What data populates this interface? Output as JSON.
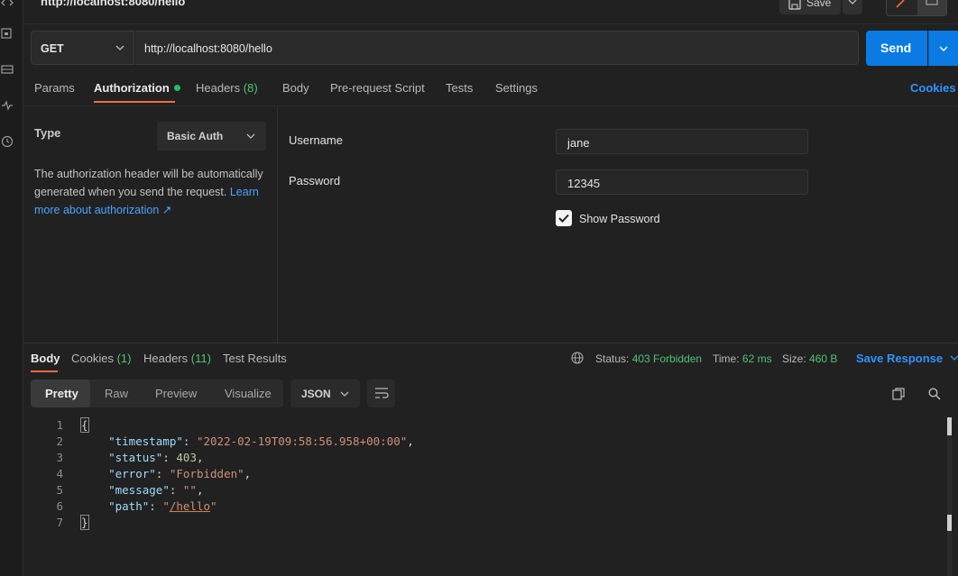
{
  "top": {
    "title": "http://localhost:8080/hello",
    "save_label": "Save"
  },
  "request": {
    "method": "GET",
    "url": "http://localhost:8080/hello",
    "send_label": "Send",
    "tabs": [
      "Params",
      "Authorization",
      "Headers",
      "Body",
      "Pre-request Script",
      "Tests",
      "Settings"
    ],
    "headers_count": "(8)",
    "cookies_label": "Cookies"
  },
  "auth": {
    "type_label": "Type",
    "type_value": "Basic Auth",
    "description": "The authorization header will be automatically generated when you send the request.",
    "learn_more": "Learn more about authorization ↗",
    "username_label": "Username",
    "username_value": "jane",
    "password_label": "Password",
    "password_value": "12345",
    "show_password_label": "Show Password",
    "show_password_checked": true
  },
  "response": {
    "tabs": [
      "Body",
      "Cookies",
      "Headers",
      "Test Results"
    ],
    "cookies_count": "(1)",
    "headers_count": "(11)",
    "status_label": "Status:",
    "status_value": "403 Forbidden",
    "time_label": "Time:",
    "time_value": "62 ms",
    "size_label": "Size:",
    "size_value": "460 B",
    "save_response_label": "Save Response",
    "view_modes": [
      "Pretty",
      "Raw",
      "Preview",
      "Visualize"
    ],
    "format": "JSON",
    "line_numbers": [
      "1",
      "2",
      "3",
      "4",
      "5",
      "6",
      "7"
    ],
    "body": {
      "open": "{",
      "close": "}",
      "timestamp_key": "\"timestamp\"",
      "timestamp_value": "\"2022-02-19T09:58:56.958+00:00\"",
      "status_key": "\"status\"",
      "status_value": "403",
      "error_key": "\"error\"",
      "error_value": "\"Forbidden\"",
      "message_key": "\"message\"",
      "message_value": "\"\"",
      "path_key": "\"path\"",
      "path_value": "/hello"
    }
  },
  "colors": {
    "accent": "#f26b3a",
    "primary": "#0b7be3",
    "link": "#2e93ff",
    "success": "#4fc277"
  }
}
